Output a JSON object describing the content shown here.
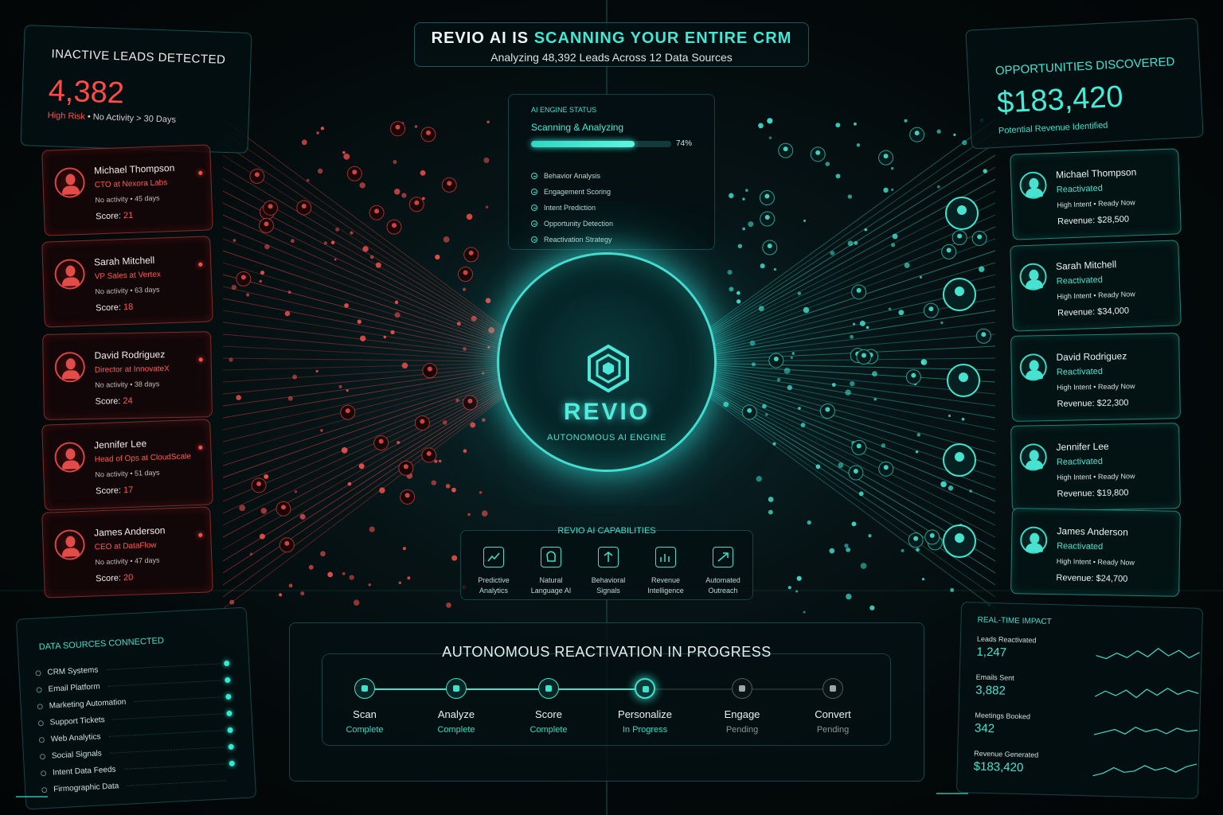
{
  "header": {
    "title_prefix": "REVIO AI IS ",
    "title_highlight": "SCANNING YOUR ENTIRE CRM",
    "subtitle": "Analyzing 48,392 Leads Across 12 Data Sources"
  },
  "inactive": {
    "title": "Inactive Leads Detected",
    "count": "4,382",
    "risk": "High Risk",
    "note": " • No Activity > 30 Days"
  },
  "inactive_leads": [
    {
      "name": "Michael Thompson",
      "role": "CTO at Nexora Labs",
      "activity": "No activity • 45 days",
      "score_label": "Score: ",
      "score": "21"
    },
    {
      "name": "Sarah Mitchell",
      "role": "VP Sales at Vertex",
      "activity": "No activity • 63 days",
      "score_label": "Score: ",
      "score": "18"
    },
    {
      "name": "David Rodriguez",
      "role": "Director at InnovateX",
      "activity": "No activity • 38 days",
      "score_label": "Score: ",
      "score": "24"
    },
    {
      "name": "Jennifer Lee",
      "role": "Head of Ops at CloudScale",
      "activity": "No activity • 51 days",
      "score_label": "Score: ",
      "score": "17"
    },
    {
      "name": "James Anderson",
      "role": "CEO at DataFlow",
      "activity": "No activity • 47 days",
      "score_label": "Score: ",
      "score": "20"
    }
  ],
  "opportunities": {
    "title": "Opportunities Discovered",
    "amount": "$183,420",
    "subtitle": "Potential Revenue Identified"
  },
  "reactivated_leads": [
    {
      "name": "Michael Thompson",
      "status": "Reactivated",
      "intent": "High Intent • Ready Now",
      "revenue": "Revenue: $28,500"
    },
    {
      "name": "Sarah Mitchell",
      "status": "Reactivated",
      "intent": "High Intent • Ready Now",
      "revenue": "Revenue: $34,000"
    },
    {
      "name": "David Rodriguez",
      "status": "Reactivated",
      "intent": "High Intent • Ready Now",
      "revenue": "Revenue: $22,300"
    },
    {
      "name": "Jennifer Lee",
      "status": "Reactivated",
      "intent": "High Intent • Ready Now",
      "revenue": "Revenue: $19,800"
    },
    {
      "name": "James Anderson",
      "status": "Reactivated",
      "intent": "High Intent • Ready Now",
      "revenue": "Revenue: $24,700"
    }
  ],
  "engine": {
    "title": "AI Engine Status",
    "state": "Scanning & Analyzing",
    "progress_label": "74%",
    "progress": 0.74,
    "tasks": [
      "Behavior Analysis",
      "Engagement Scoring",
      "Intent Prediction",
      "Opportunity Detection",
      "Reactivation Strategy"
    ]
  },
  "core": {
    "brand": "REVIO",
    "tagline": "AUTONOMOUS AI ENGINE"
  },
  "capabilities": {
    "title": "REVIO AI CAPABILITIES",
    "items": [
      {
        "line1": "Predictive",
        "line2": "Analytics",
        "icon": "chart-icon"
      },
      {
        "line1": "Natural",
        "line2": "Language AI",
        "icon": "brain-icon"
      },
      {
        "line1": "Behavioral",
        "line2": "Signals",
        "icon": "signal-icon"
      },
      {
        "line1": "Revenue",
        "line2": "Intelligence",
        "icon": "revenue-icon"
      },
      {
        "line1": "Automated",
        "line2": "Outreach",
        "icon": "send-icon"
      }
    ]
  },
  "sources": {
    "title": "Data Sources Connected",
    "items": [
      "CRM Systems",
      "Email Platform",
      "Marketing Automation",
      "Support Tickets",
      "Web Analytics",
      "Social Signals",
      "Intent Data Feeds",
      "Firmographic Data"
    ]
  },
  "reactivation": {
    "title": "AUTONOMOUS REACTIVATION IN PROGRESS",
    "steps": [
      {
        "label": "Scan",
        "status": "Complete",
        "state": "complete"
      },
      {
        "label": "Analyze",
        "status": "Complete",
        "state": "complete"
      },
      {
        "label": "Score",
        "status": "Complete",
        "state": "complete"
      },
      {
        "label": "Personalize",
        "status": "In Progress",
        "state": "progress"
      },
      {
        "label": "Engage",
        "status": "Pending",
        "state": "pending"
      },
      {
        "label": "Convert",
        "status": "Pending",
        "state": "pending"
      }
    ]
  },
  "impact": {
    "title": "Real-Time Impact",
    "metrics": [
      {
        "label": "Leads Reactivated",
        "value": "1,247"
      },
      {
        "label": "Emails Sent",
        "value": "3,882"
      },
      {
        "label": "Meetings Booked",
        "value": "342"
      },
      {
        "label": "Revenue Generated",
        "value": "$183,420"
      }
    ]
  },
  "colors": {
    "accent": "#3ee6d2",
    "danger": "#ff4b48",
    "background": "#030809"
  }
}
